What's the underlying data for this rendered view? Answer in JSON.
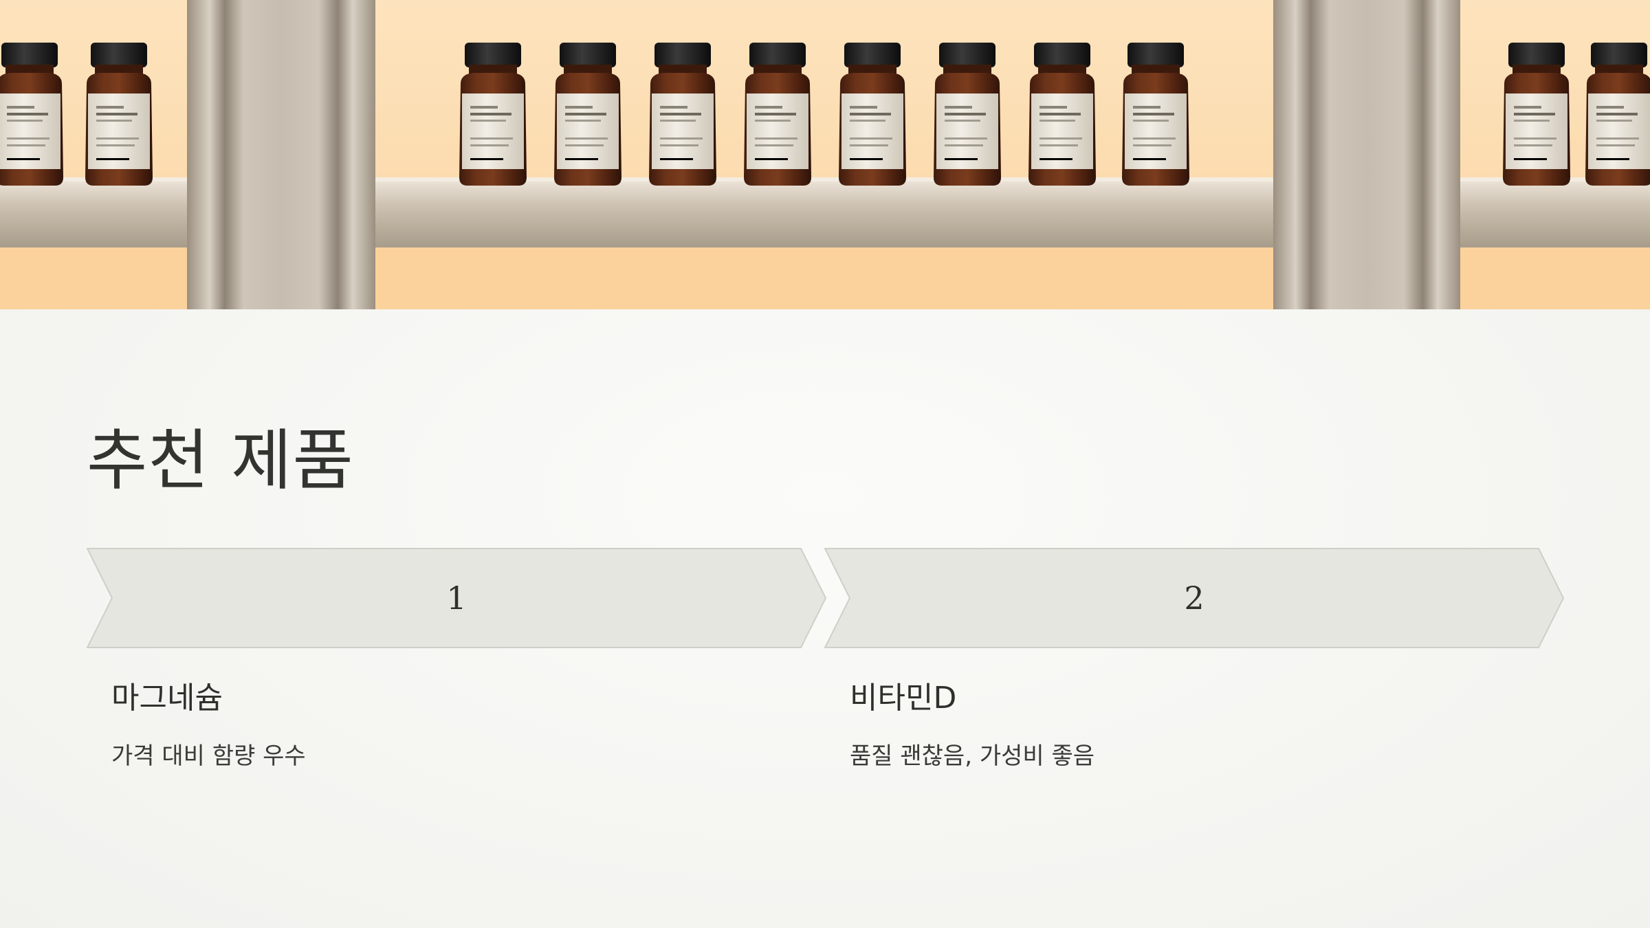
{
  "slide": {
    "title": "추천 제품"
  },
  "steps": [
    {
      "number": "1",
      "title": "마그네슘",
      "description": "가격 대비 함량 우수"
    },
    {
      "number": "2",
      "title": "비타민D",
      "description": "품질 괜찮음, 가성비 좋음"
    }
  ],
  "colors": {
    "background": "#f6f6f3",
    "chevron_fill": "#e6e6e1",
    "chevron_stroke": "#cfcfc8",
    "text": "#33332f",
    "shelf_glow": "#fcdcb0",
    "bottle_amber": "#5a2a17"
  }
}
